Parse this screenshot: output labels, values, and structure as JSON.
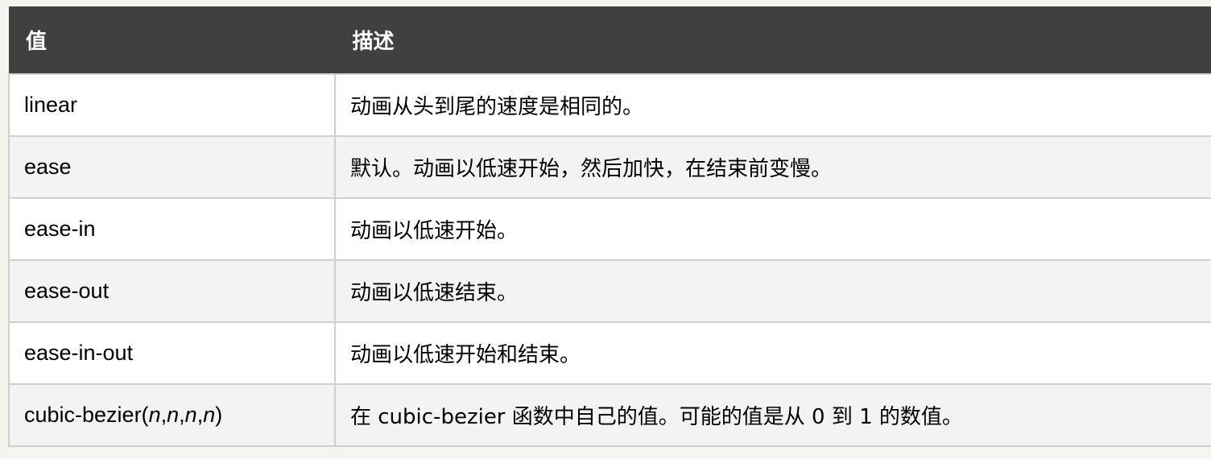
{
  "table": {
    "headers": [
      "值",
      "描述"
    ],
    "rows": [
      {
        "value": "linear",
        "description": "动画从头到尾的速度是相同的。"
      },
      {
        "value": "ease",
        "description": "默认。动画以低速开始，然后加快，在结束前变慢。"
      },
      {
        "value": "ease-in",
        "description": "动画以低速开始。"
      },
      {
        "value": "ease-out",
        "description": "动画以低速结束。"
      },
      {
        "value": "ease-in-out",
        "description": "动画以低速开始和结束。"
      },
      {
        "value_prefix": "cubic-bezier(",
        "value_args": [
          "n",
          "n",
          "n",
          "n"
        ],
        "value_suffix": ")",
        "description": "在 cubic-bezier 函数中自己的值。可能的值是从 0 到 1 的数值。"
      }
    ]
  }
}
